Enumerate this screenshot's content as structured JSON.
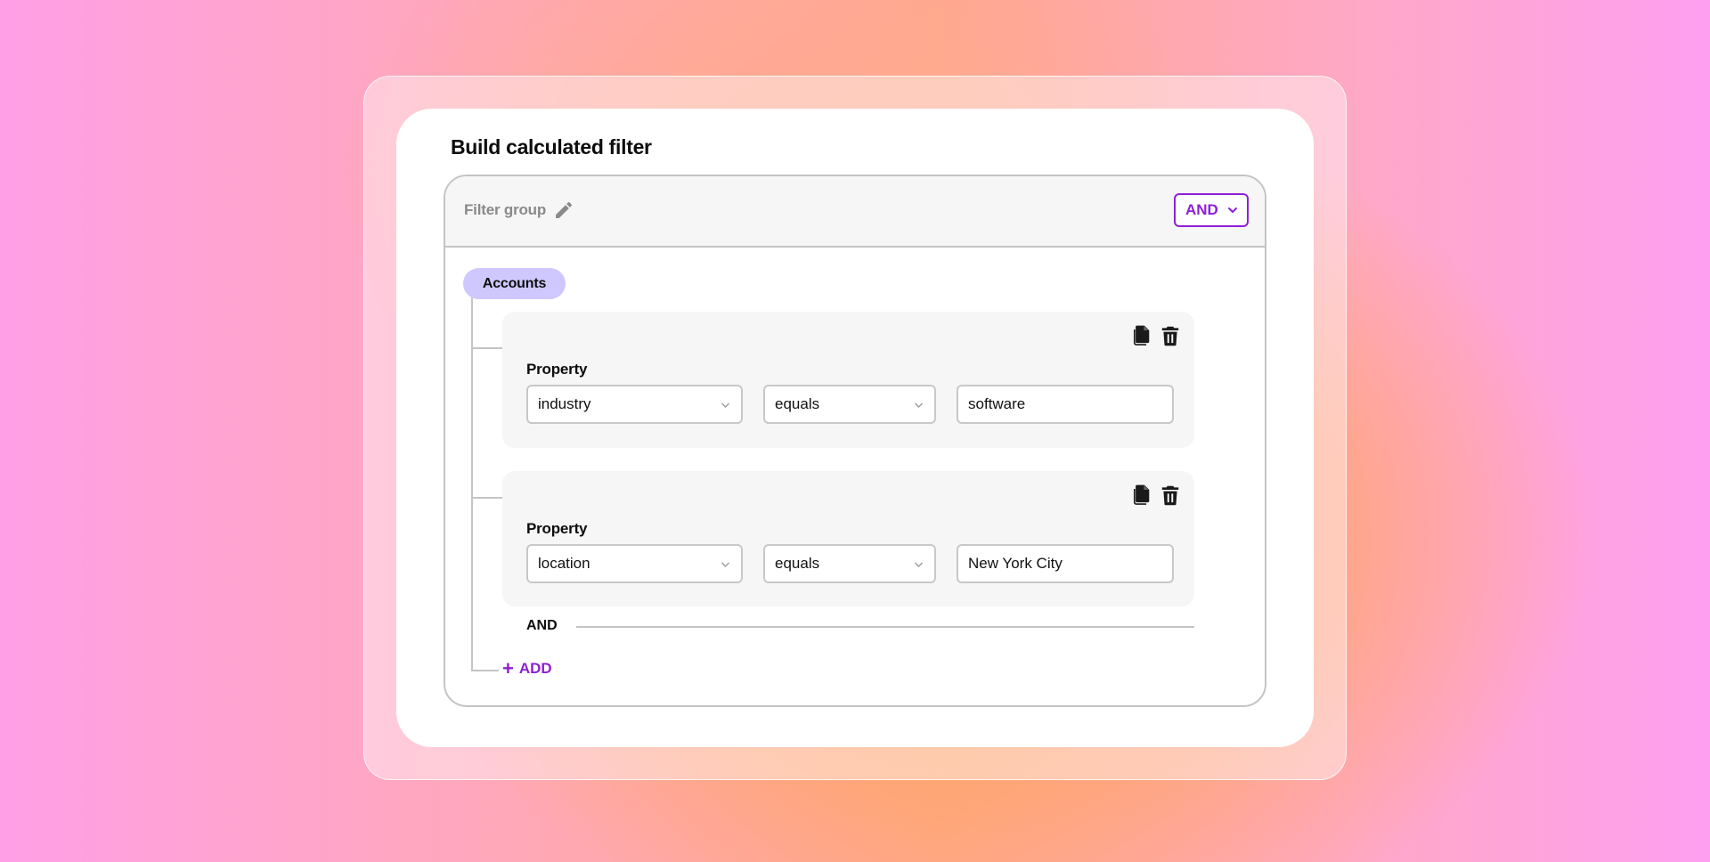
{
  "dialog": {
    "title": "Build calculated filter"
  },
  "filter_group": {
    "label": "Filter group",
    "edit_icon": "pencil-icon",
    "operator": "AND",
    "object_tag": "Accounts"
  },
  "rules": [
    {
      "label": "Property",
      "property": "industry",
      "operator": "equals",
      "value": "software",
      "actions": [
        "copy-icon",
        "trash-icon"
      ]
    },
    {
      "label": "Property",
      "property": "location",
      "operator": "equals",
      "value": "New York City",
      "actions": [
        "copy-icon",
        "trash-icon"
      ]
    }
  ],
  "separator": {
    "label": "AND"
  },
  "add_button": {
    "icon": "+",
    "label": "ADD"
  },
  "colors": {
    "accent": "#8f1fd6",
    "tag_bg": "#cfc8ff",
    "rule_bg": "#f6f6f6",
    "border": "#c4c4c4"
  }
}
